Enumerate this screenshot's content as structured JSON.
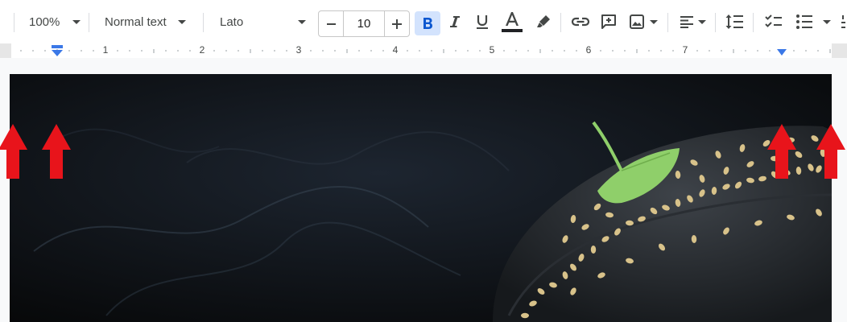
{
  "toolbar": {
    "zoom": "100%",
    "paragraph_style": "Normal text",
    "font": "Lato",
    "font_size": "10",
    "decrease_font_size_symbol": "−",
    "increase_font_size_symbol": "+",
    "text_color": "#202124",
    "active_format": "bold",
    "active_color": "#0b57d0",
    "active_bg": "#d3e3fd",
    "icons": [
      "paint-format-icon",
      "chevron-down-icon",
      "minus-icon",
      "plus-icon",
      "bold-icon",
      "italic-icon",
      "underline-icon",
      "text-color-icon",
      "highlight-icon",
      "link-icon",
      "add-comment-icon",
      "insert-image-icon",
      "align-icon",
      "line-spacing-icon",
      "checklist-icon",
      "bulleted-list-icon",
      "numbered-list-icon"
    ]
  },
  "ruler": {
    "numbers": [
      "1",
      "2",
      "3",
      "4",
      "5",
      "6",
      "7"
    ],
    "marker_color": "#3b78e7"
  },
  "annotations": {
    "arrow_color": "#e8141b"
  }
}
